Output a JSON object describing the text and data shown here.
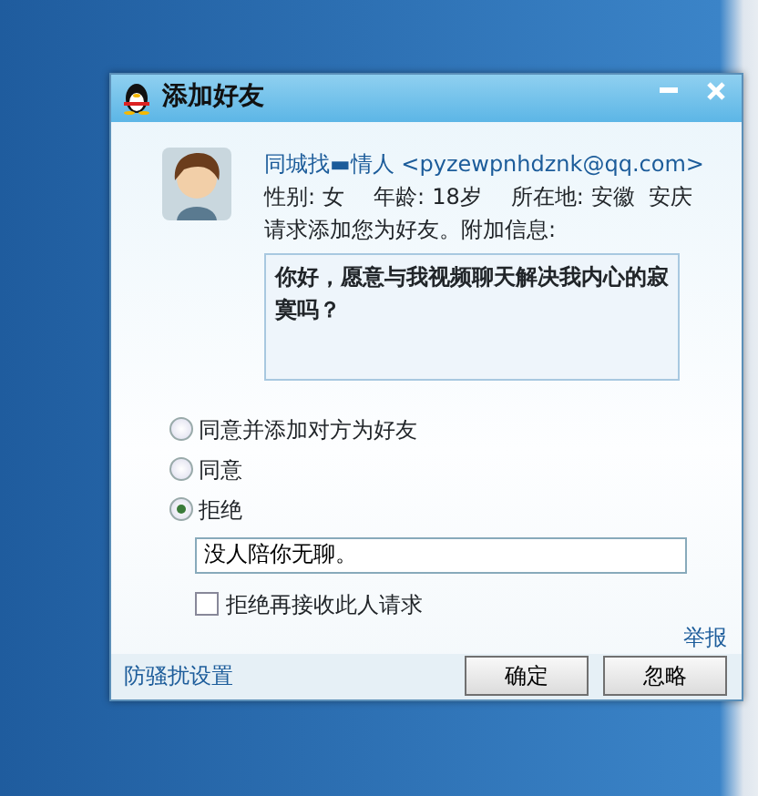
{
  "window": {
    "title": "添加好友"
  },
  "requester": {
    "name": "同城找▬情人",
    "email": "<pyzewpnhdznk@qq.com>",
    "gender_label": "性别:",
    "gender": "女",
    "age_label": "年龄:",
    "age": "18岁",
    "location_label": "所在地:",
    "location": "安徽  安庆",
    "request_text": "请求添加您为好友。附加信息:",
    "message": "你好，愿意与我视频聊天解决我内心的寂寞吗？"
  },
  "options": [
    {
      "label": "同意并添加对方为好友",
      "selected": false
    },
    {
      "label": "同意",
      "selected": false
    },
    {
      "label": "拒绝",
      "selected": true
    }
  ],
  "reject_reason": {
    "value": "没人陪你无聊。"
  },
  "block_checkbox": {
    "label": "拒绝再接收此人请求",
    "checked": false
  },
  "report_link": "举报",
  "settings_link": "防骚扰设置",
  "buttons": [
    "确定",
    "忽略"
  ]
}
